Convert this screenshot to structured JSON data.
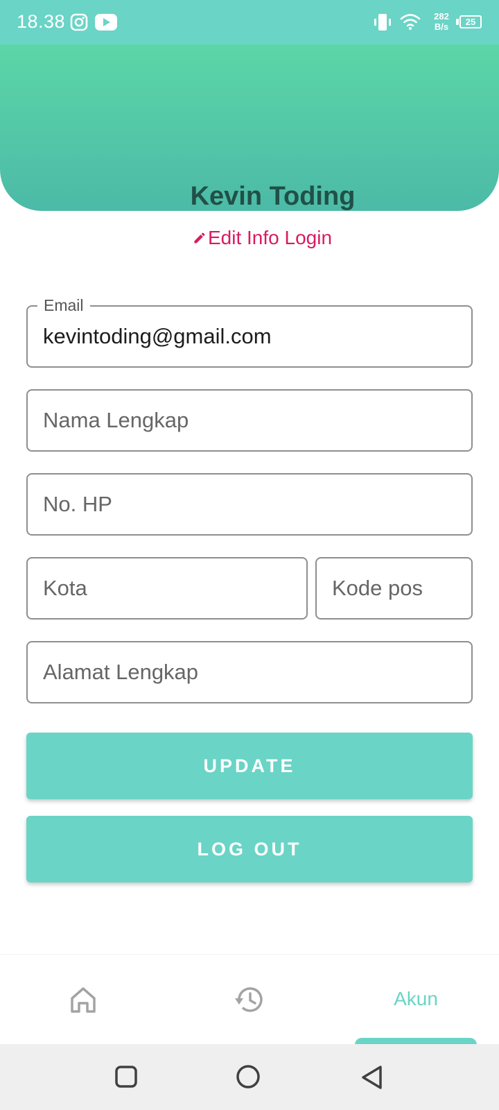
{
  "status_bar": {
    "time": "18.38",
    "net_speed_value": "282",
    "net_speed_unit": "B/s",
    "battery": "25",
    "icons": [
      "instagram-icon",
      "youtube-icon",
      "vibrate-icon",
      "wifi-icon",
      "battery-icon"
    ]
  },
  "profile": {
    "name": "Kevin Toding",
    "edit_label": "Edit Info Login"
  },
  "form": {
    "email_label": "Email",
    "email_value": "kevintoding@gmail.com",
    "full_name_placeholder": "Nama Lengkap",
    "phone_placeholder": "No. HP",
    "city_placeholder": "Kota",
    "postal_placeholder": "Kode pos",
    "address_placeholder": "Alamat Lengkap"
  },
  "buttons": {
    "update": "UPDATE",
    "logout": "LOG OUT"
  },
  "bottom_nav": {
    "items": [
      {
        "icon": "home-icon",
        "label": ""
      },
      {
        "icon": "history-icon",
        "label": ""
      },
      {
        "icon": "",
        "label": "Akun"
      }
    ],
    "active_index": 2
  },
  "colors": {
    "accent": "#6ad4c6",
    "header_top": "#5cd6a7",
    "header_bottom": "#4cbaa7",
    "name_text": "#205047",
    "edit_link": "#d81b60"
  }
}
